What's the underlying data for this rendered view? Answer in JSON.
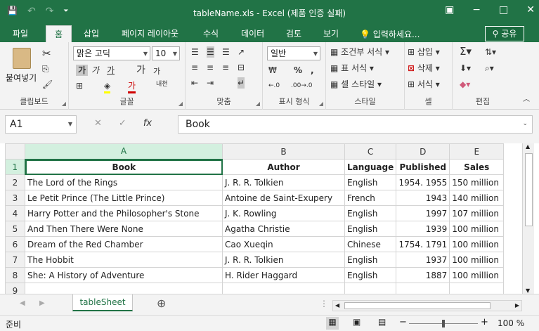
{
  "window": {
    "title": "tableName.xls - Excel (제품 인증 실패)",
    "minimize": "−",
    "restore": "□",
    "close": "✕",
    "ribbon_display": "▣"
  },
  "qat": {
    "save": "💾",
    "undo": "↶",
    "redo": "↷",
    "customize": "⏷"
  },
  "tabs": [
    "파일",
    "홈",
    "삽입",
    "페이지 레이아웃",
    "수식",
    "데이터",
    "검토",
    "보기"
  ],
  "active_tab": "홈",
  "tell_me": "입력하세요...",
  "share_label": "공유",
  "ribbon": {
    "clipboard": {
      "label": "클립보드",
      "paste": "붙여넣기"
    },
    "font": {
      "label": "글꼴",
      "font_name": "맑은 고딕",
      "font_size": "10",
      "bold": "가",
      "italic": "가",
      "underline": "가",
      "grow": "가",
      "shrink": "가",
      "phonetic": "내천",
      "font_color": "가"
    },
    "alignment": {
      "label": "맞춤"
    },
    "number": {
      "label": "표시 형식",
      "format": "일반",
      "percent": "%",
      "comma": ",",
      "inc": "←.0",
      "dec": ".00→.0"
    },
    "styles": {
      "label": "스타일",
      "conditional": "조건부 서식",
      "table": "표 서식",
      "cell": "셀 스타일"
    },
    "cells": {
      "label": "셀",
      "insert": "삽입",
      "delete": "삭제",
      "format": "서식"
    },
    "editing": {
      "label": "편집"
    }
  },
  "formula_bar": {
    "name_box": "A1",
    "fx": "fx",
    "cancel": "✕",
    "enter": "✓",
    "value": "Book"
  },
  "columns": [
    "A",
    "B",
    "C",
    "D",
    "E"
  ],
  "rows": [
    "1",
    "2",
    "3",
    "4",
    "5",
    "6",
    "7",
    "8",
    "9"
  ],
  "cells": [
    [
      "Book",
      "Author",
      "Language",
      "Published",
      "Sales"
    ],
    [
      "The Lord of the Rings",
      "J. R. R. Tolkien",
      "English",
      "1954. 1955",
      "150 million"
    ],
    [
      "Le Petit Prince (The Little Prince)",
      "Antoine de Saint-Exupery",
      "French",
      "1943",
      "140 million"
    ],
    [
      "Harry Potter and the Philosopher's Stone",
      "J. K. Rowling",
      "English",
      "1997",
      "107 million"
    ],
    [
      "And Then There Were None",
      "Agatha Christie",
      "English",
      "1939",
      "100 million"
    ],
    [
      "Dream of the Red Chamber",
      "Cao Xueqin",
      "Chinese",
      "1754. 1791",
      "100 million"
    ],
    [
      "The Hobbit",
      "J. R. R. Tolkien",
      "English",
      "1937",
      "100 million"
    ],
    [
      "She: A History of Adventure",
      "H. Rider Haggard",
      "English",
      "1887",
      "100 million"
    ],
    [
      "",
      "",
      "",
      "",
      ""
    ]
  ],
  "sheet_tab": "tableSheet",
  "add_sheet": "⊕",
  "status": {
    "ready": "준비",
    "zoom": "100 %",
    "minus": "−",
    "plus": "+"
  },
  "colors": {
    "accent": "#217346",
    "selection_header": "#d3f0df"
  }
}
